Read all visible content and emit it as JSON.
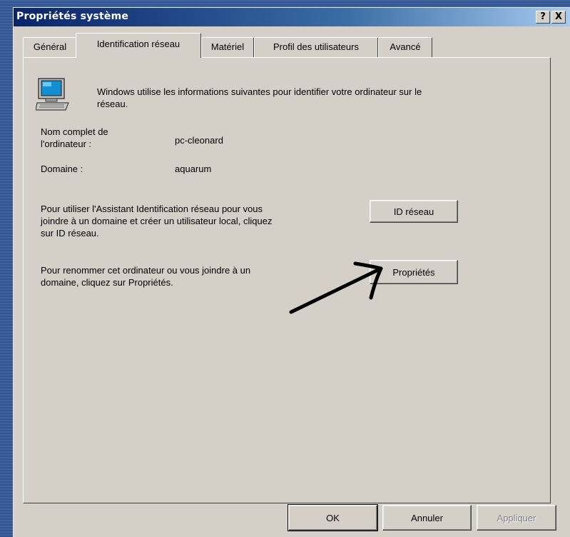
{
  "window": {
    "title": "Propriétés système"
  },
  "titlebar_buttons": {
    "help": "?",
    "close": "X"
  },
  "tabs": [
    {
      "label": "Général"
    },
    {
      "label": "Identification réseau"
    },
    {
      "label": "Matériel"
    },
    {
      "label": "Profil des utilisateurs"
    },
    {
      "label": "Avancé"
    }
  ],
  "active_tab": "Identification réseau",
  "intro": "Windows utilise les informations suivantes pour identifier votre ordinateur sur le réseau.",
  "fields": {
    "computer_name_label_line1": "Nom complet de",
    "computer_name_label_line2": "l'ordinateur :",
    "computer_name_value": "pc-cleonard",
    "domain_label": "Domaine :",
    "domain_value": "aquarum"
  },
  "network_id": {
    "description_line1": "Pour utiliser l'Assistant Identification réseau pour vous",
    "description_line2": "joindre à un domaine et créer un utilisateur local, cliquez",
    "description_line3": "sur ID réseau.",
    "button_label": "ID réseau"
  },
  "rename": {
    "description_line1": "Pour renommer cet ordinateur ou vous joindre à un",
    "description_line2": "domaine, cliquez sur Propriétés.",
    "button_label": "Propriétés"
  },
  "footer": {
    "ok_label": "OK",
    "cancel_label": "Annuler",
    "apply_label": "Appliquer"
  }
}
